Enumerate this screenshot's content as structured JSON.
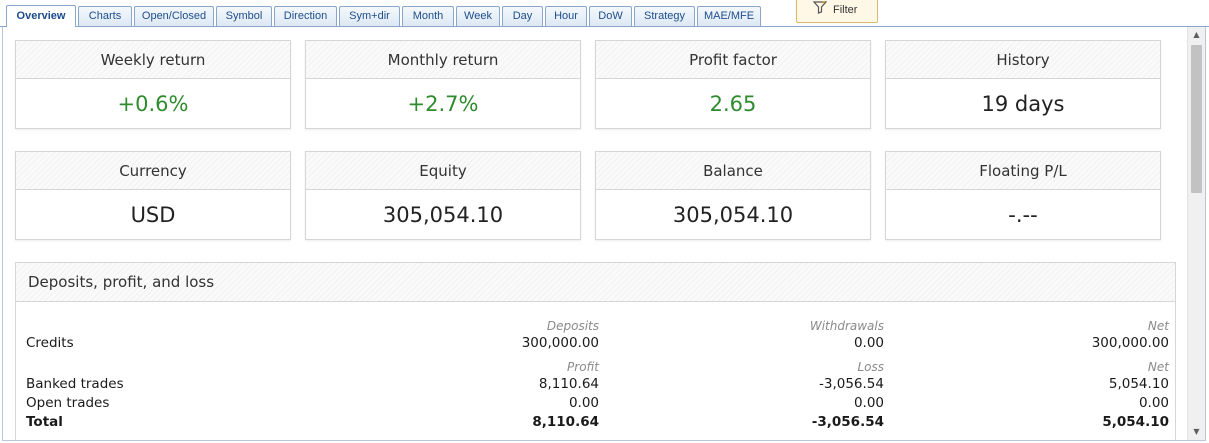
{
  "tabs": [
    {
      "label": "Overview",
      "active": true
    },
    {
      "label": "Charts"
    },
    {
      "label": "Open/Closed"
    },
    {
      "label": "Symbol"
    },
    {
      "label": "Direction"
    },
    {
      "label": "Sym+dir"
    },
    {
      "label": "Month"
    },
    {
      "label": "Week"
    },
    {
      "label": "Day"
    },
    {
      "label": "Hour"
    },
    {
      "label": "DoW"
    },
    {
      "label": "Strategy"
    },
    {
      "label": "MAE/MFE"
    }
  ],
  "filter": {
    "label": "Filter"
  },
  "cards": [
    {
      "title": "Weekly return",
      "value": "+0.6%",
      "status": "positive"
    },
    {
      "title": "Monthly return",
      "value": "+2.7%",
      "status": "positive"
    },
    {
      "title": "Profit factor",
      "value": "2.65",
      "status": "positive"
    },
    {
      "title": "History",
      "value": "19 days"
    },
    {
      "title": "Currency",
      "value": "USD"
    },
    {
      "title": "Equity",
      "value": "305,054.10"
    },
    {
      "title": "Balance",
      "value": "305,054.10"
    },
    {
      "title": "Floating P/L",
      "value": "-.--"
    }
  ],
  "colors": {
    "positive": "#2e8b2e",
    "tab_text": "#1f4e8c"
  },
  "deposits": {
    "title": "Deposits, profit, and loss",
    "credit_headers": {
      "c1": "Deposits",
      "c2": "Withdrawals",
      "c3": "Net"
    },
    "credits": {
      "label": "Credits",
      "c1": "300,000.00",
      "c2": "0.00",
      "c3": "300,000.00"
    },
    "trade_headers": {
      "c1": "Profit",
      "c2": "Loss",
      "c3": "Net"
    },
    "banked": {
      "label": "Banked trades",
      "c1": "8,110.64",
      "c2": "-3,056.54",
      "c3": "5,054.10"
    },
    "open": {
      "label": "Open trades",
      "c1": "0.00",
      "c2": "0.00",
      "c3": "0.00"
    },
    "total": {
      "label": "Total",
      "c1": "8,110.64",
      "c2": "-3,056.54",
      "c3": "5,054.10"
    }
  }
}
